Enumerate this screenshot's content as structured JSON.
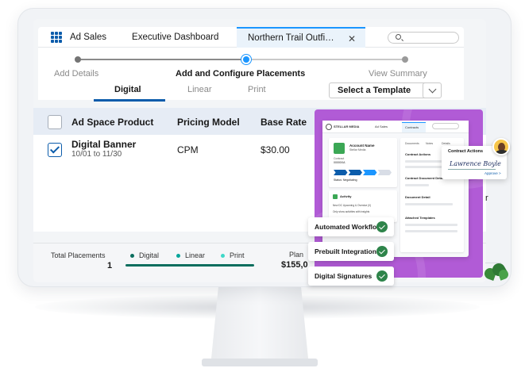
{
  "tabbar": {
    "app_name": "Ad Sales",
    "tabs": [
      "Executive Dashboard"
    ],
    "active_tab": "Northern Trail Outfi…",
    "close_glyph": "✕"
  },
  "path": {
    "steps": [
      "Add Details",
      "Add and Configure Placements",
      "View Summary"
    ]
  },
  "channels": {
    "tabs": [
      "Digital",
      "Linear",
      "Print"
    ],
    "template_button": "Select a Template"
  },
  "table": {
    "headers": [
      "Ad Space Product",
      "Pricing Model",
      "Base Rate"
    ],
    "rows": [
      {
        "name": "Digital Banner",
        "dates": "10/01 to 11/30",
        "pricing": "CPM",
        "rate": "$30.00"
      }
    ]
  },
  "footer": {
    "total_label": "Total Placements",
    "total_value": "1",
    "legend": [
      "Digital",
      "Linear",
      "Print"
    ],
    "planned_label": "Plan",
    "planned_amount": "$155,0"
  },
  "overlay": {
    "brand": "STELLAR MEDIA",
    "app": "Ad Sales",
    "tab": "Contracts",
    "account_title": "Account Name",
    "account_sub": "Stellar Media",
    "contract_label": "Contract",
    "contract_num": "00000XA",
    "status": "Status: Negotiating",
    "activity_title": "Activity",
    "activity_lines": [
      "New DC   Upcoming & Overdue (0)",
      "Only show activities with insights"
    ],
    "right_tabs": [
      "Documents",
      "Notes",
      "Details"
    ],
    "right_heads": [
      "Contract Actions",
      "Contract Document Details",
      "Document Detail",
      "Attached Templates"
    ],
    "contract_actions_title": "Contract Actions",
    "signature": "Lawrence Boyle",
    "approve_label": "Approve >"
  },
  "features": [
    "Automated Workflows",
    "Prebuilt Integrations",
    "Digital Signatures"
  ],
  "partial_right_glyph": "r",
  "colors": {
    "brand_blue": "#0b5cab",
    "accent_blue": "#1b96ff",
    "purple": "#b15bd6",
    "success_green": "#2e844a",
    "legend_digital": "#0b6e5e",
    "legend_linear": "#06a59a",
    "legend_print": "#3fd8c8"
  }
}
